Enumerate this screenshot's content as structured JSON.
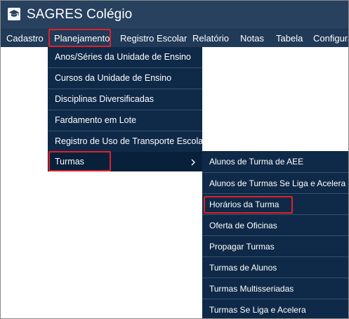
{
  "app": {
    "title": "SAGRES Colégio",
    "icon": "graduation-cap-icon"
  },
  "menubar": {
    "items": [
      "Cadastro",
      "Planejamento",
      "Registro Escolar",
      "Relatório",
      "Notas",
      "Tabela",
      "Configura"
    ]
  },
  "planejamento_menu": {
    "items": [
      "Anos/Séries da Unidade de Ensino",
      "Cursos da Unidade de Ensino",
      "Disciplinas Diversificadas",
      "Fardamento em Lote",
      "Registro de Uso de Transporte Escolar",
      "Turmas"
    ]
  },
  "turmas_submenu": {
    "items": [
      "Alunos de Turma de AEE",
      "Alunos de Turmas Se Liga e Acelera",
      "Horários da Turma",
      "Oferta de Oficinas",
      "Propagar Turmas",
      "Turmas de Alunos",
      "Turmas Multisseriadas",
      "Turmas Se Liga e Acelera"
    ]
  },
  "colors": {
    "titlebar": "#27415f",
    "menubar": "#203a58",
    "menu_panel": "#0f2a48",
    "highlight_box": "#e0202a"
  }
}
